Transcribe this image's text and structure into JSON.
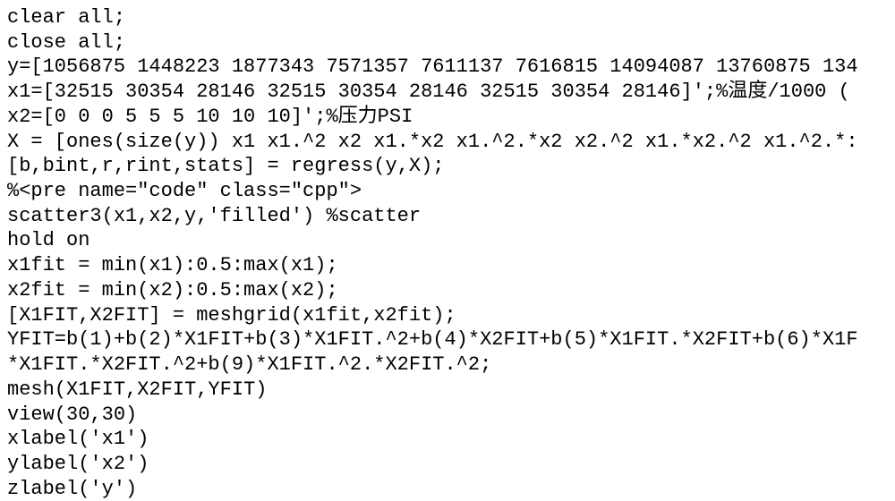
{
  "code": {
    "lines": [
      "clear all;",
      "close all;",
      "y=[1056875 1448223 1877343 7571357 7611137 7616815 14094087 13760875 134",
      "x1=[32515 30354 28146 32515 30354 28146 32515 30354 28146]';%温度/1000 (",
      "x2=[0 0 0 5 5 5 10 10 10]';%压力PSI",
      "X = [ones(size(y)) x1 x1.^2 x2 x1.*x2 x1.^2.*x2 x2.^2 x1.*x2.^2 x1.^2.*:",
      "[b,bint,r,rint,stats] = regress(y,X);",
      "%<pre name=\"code\" class=\"cpp\">",
      "scatter3(x1,x2,y,'filled') %scatter",
      "hold on",
      "x1fit = min(x1):0.5:max(x1);",
      "x2fit = min(x2):0.5:max(x2);",
      "[X1FIT,X2FIT] = meshgrid(x1fit,x2fit);",
      "YFIT=b(1)+b(2)*X1FIT+b(3)*X1FIT.^2+b(4)*X2FIT+b(5)*X1FIT.*X2FIT+b(6)*X1F",
      "*X1FIT.*X2FIT.^2+b(9)*X1FIT.^2.*X2FIT.^2;",
      "mesh(X1FIT,X2FIT,YFIT)",
      "view(30,30)",
      "xlabel('x1')",
      "ylabel('x2')",
      "zlabel('y')"
    ]
  }
}
